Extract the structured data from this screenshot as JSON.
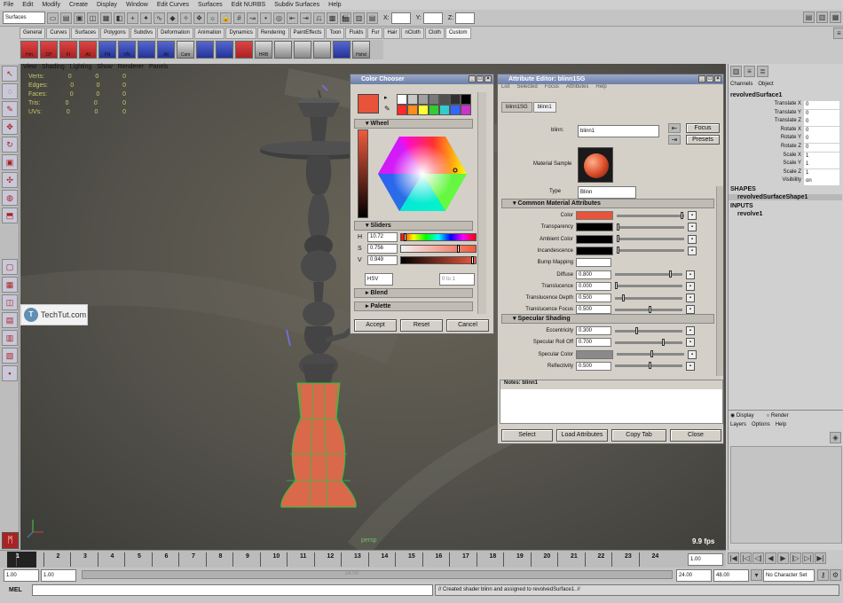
{
  "menubar": [
    "File",
    "Edit",
    "Modify",
    "Create",
    "Display",
    "Window",
    "Edit Curves",
    "Surfaces",
    "Edit NURBS",
    "Subdiv Surfaces",
    "Help"
  ],
  "status": {
    "menu_set": "Surfaces",
    "x_label": "X:",
    "y_label": "Y:",
    "z_label": "Z:"
  },
  "shelf_tabs": [
    {
      "label": "General"
    },
    {
      "label": "Curves"
    },
    {
      "label": "Surfaces"
    },
    {
      "label": "Polygons"
    },
    {
      "label": "Subdivs"
    },
    {
      "label": "Deformation"
    },
    {
      "label": "Animation"
    },
    {
      "label": "Dynamics"
    },
    {
      "label": "Rendering"
    },
    {
      "label": "PaintEffects"
    },
    {
      "label": "Toon"
    },
    {
      "label": "Fluids"
    },
    {
      "label": "Fur"
    },
    {
      "label": "Hair"
    },
    {
      "label": "nCloth"
    },
    {
      "label": "Cloth"
    },
    {
      "label": "Custom",
      "active": true
    }
  ],
  "shelf_buttons": [
    {
      "label": "Hm",
      "style": "red"
    },
    {
      "label": "CP",
      "style": "red"
    },
    {
      "label": "FI",
      "style": "red"
    },
    {
      "label": "All",
      "style": "red"
    },
    {
      "label": "FN",
      "style": "blue"
    },
    {
      "label": "VN",
      "style": "blue"
    },
    {
      "label": "",
      "style": "blue"
    },
    {
      "label": "All",
      "style": "blue"
    },
    {
      "label": "Cam",
      "style": "gray"
    },
    {
      "label": "",
      "style": "blue"
    },
    {
      "label": "",
      "style": "blue"
    },
    {
      "label": "",
      "style": "red"
    },
    {
      "label": "HRB",
      "style": "gray"
    },
    {
      "label": "",
      "style": "gray"
    },
    {
      "label": "",
      "style": "gray"
    },
    {
      "label": "",
      "style": "gray"
    },
    {
      "label": "",
      "style": "blue"
    },
    {
      "label": "Hshd",
      "style": "gray"
    }
  ],
  "viewport": {
    "menu": [
      "View",
      "Shading",
      "Lighting",
      "Show",
      "Renderer",
      "Panels"
    ],
    "hud": [
      {
        "label": "Verts:",
        "a": "0",
        "b": "0",
        "c": "0"
      },
      {
        "label": "Edges:",
        "a": "0",
        "b": "0",
        "c": "0"
      },
      {
        "label": "Faces:",
        "a": "0",
        "b": "0",
        "c": "0"
      },
      {
        "label": "Tris:",
        "a": "0",
        "b": "0",
        "c": "0"
      },
      {
        "label": "UVs:",
        "a": "0",
        "b": "0",
        "c": "0"
      }
    ],
    "camera": "persp",
    "fps": "9.9 fps",
    "model_color": "#d9694a"
  },
  "watermark": {
    "logo": "T",
    "text": "TechTut.com"
  },
  "color_chooser": {
    "title": "Color Chooser",
    "current_color": "#e7543a",
    "palette": [
      "#ffffff",
      "#c8c8c8",
      "#a0a0a0",
      "#787878",
      "#505050",
      "#303030",
      "#000000",
      "#ff2a2a",
      "#ff8c1a",
      "#ffff33",
      "#33cc33",
      "#33cccc",
      "#3366ff",
      "#cc33cc"
    ],
    "wheel_label": "Wheel",
    "sliders_label": "Sliders",
    "h_label": "H",
    "h_value": "10.72",
    "s_label": "S",
    "s_value": "0.756",
    "v_label": "V",
    "v_value": "0.949",
    "mode": "HSV",
    "range": "0 to 1",
    "blend_label": "Blend",
    "palette_label": "Palette",
    "accept": "Accept",
    "reset": "Reset",
    "cancel": "Cancel"
  },
  "attr_editor": {
    "title": "Attribute Editor: blinn1SG",
    "menu": [
      "List",
      "Selected",
      "Focus",
      "Attributes",
      "Help"
    ],
    "tabs": [
      {
        "label": "blinn1SG"
      },
      {
        "label": "blinn1",
        "active": true
      }
    ],
    "node_label": "blinn:",
    "node_value": "blinn1",
    "focus": "Focus",
    "presets": "Presets",
    "material_sample_label": "Material Sample",
    "type_label": "Type",
    "type_value": "Blinn",
    "common_section": "Common Material Attributes",
    "common_rows": [
      {
        "label": "Color",
        "box": "#e7543a",
        "slider": 0.95
      },
      {
        "label": "Transparency",
        "box": "#000000",
        "slider": 0.0
      },
      {
        "label": "Ambient Color",
        "box": "#000000",
        "slider": 0.0
      },
      {
        "label": "Incandescence",
        "box": "#000000",
        "slider": 0.0
      },
      {
        "label": "Bump Mapping",
        "value": "",
        "slider": null
      },
      {
        "label": "Diffuse",
        "value": "0.800",
        "slider": 0.8
      },
      {
        "label": "Translucence",
        "value": "0.000",
        "slider": 0.0
      },
      {
        "label": "Translucence Depth",
        "value": "0.500",
        "slider": 0.1
      },
      {
        "label": "Translucence Focus",
        "value": "0.500",
        "slider": 0.5
      }
    ],
    "specular_section": "Specular Shading",
    "specular_rows": [
      {
        "label": "Eccentricity",
        "value": "0.300",
        "slider": 0.3
      },
      {
        "label": "Specular Roll Off",
        "value": "0.700",
        "slider": 0.7
      },
      {
        "label": "Specular Color",
        "box": "#8a8a8a",
        "slider": 0.5
      },
      {
        "label": "Reflectivity",
        "value": "0.500",
        "slider": 0.5
      }
    ],
    "notes_label": "Notes:",
    "notes_node": "blinn1",
    "select": "Select",
    "load_attributes": "Load Attributes",
    "copy_tab": "Copy Tab",
    "close": "Close"
  },
  "channel_box": {
    "menu": [
      "Channels",
      "Object"
    ],
    "object_name": "revolvedSurface1",
    "channels": [
      {
        "name": "Translate X",
        "value": "0"
      },
      {
        "name": "Translate Y",
        "value": "0"
      },
      {
        "name": "Translate Z",
        "value": "0"
      },
      {
        "name": "Rotate X",
        "value": "0"
      },
      {
        "name": "Rotate Y",
        "value": "0"
      },
      {
        "name": "Rotate Z",
        "value": "0"
      },
      {
        "name": "Scale X",
        "value": "1"
      },
      {
        "name": "Scale Y",
        "value": "1"
      },
      {
        "name": "Scale Z",
        "value": "1"
      },
      {
        "name": "Visibility",
        "value": "on"
      }
    ],
    "shapes_label": "SHAPES",
    "shape_name": "revolvedSurfaceShape1",
    "inputs_label": "INPUTS",
    "input_name": "revolve1",
    "display_label": "Display",
    "render_label": "Render",
    "layer_menu": [
      "Layers",
      "Options",
      "Help"
    ]
  },
  "timeline": {
    "ticks": [
      "1",
      "2",
      "3",
      "4",
      "5",
      "6",
      "7",
      "8",
      "9",
      "10",
      "11",
      "12",
      "13",
      "14",
      "15",
      "16",
      "17",
      "18",
      "19",
      "20",
      "21",
      "22",
      "23",
      "24"
    ],
    "current_frame": "1.00"
  },
  "range": {
    "start": "1.00",
    "playback_start": "1.00",
    "playback_end": "24.00",
    "end": "48.00",
    "character_set": "No Character Set",
    "slider_value": "24.00"
  },
  "command": {
    "label": "MEL",
    "feedback": "// Created shader blinn and assigned to revolvedSurface1. //"
  }
}
